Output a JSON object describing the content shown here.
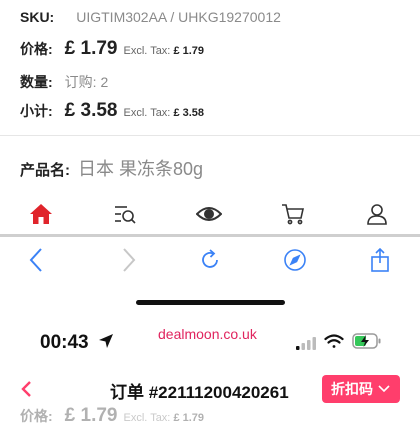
{
  "product": {
    "sku_label": "SKU:",
    "sku_value": "UIGTIM302AA / UHKG19270012",
    "price_label": "价格:",
    "price_value": "£ 1.79",
    "price_tax_label": "Excl. Tax:",
    "price_tax_value": "£ 1.79",
    "qty_label": "数量:",
    "qty_value": "订购: 2",
    "subtotal_label": "小计:",
    "subtotal_value": "£ 3.58",
    "subtotal_tax_label": "Excl. Tax:",
    "subtotal_tax_value": "£ 3.58",
    "name_label": "产品名:",
    "name_value": "日本 果冻条80g"
  },
  "tabbar": {
    "icons": [
      "home-icon",
      "search-list-icon",
      "eye-icon",
      "cart-icon",
      "profile-icon"
    ],
    "active_color": "#e0242b"
  },
  "browser": {
    "icons": [
      "back-icon",
      "forward-icon",
      "reload-icon",
      "compass-icon",
      "share-icon"
    ],
    "accent": "#3b82f6"
  },
  "status_bar": {
    "time": "00:43",
    "url": "dealmoon.co.uk"
  },
  "order": {
    "title": "订单 #22111200420261",
    "coupon_label": "折扣码",
    "partial_price_label": "价格:",
    "partial_price_value": "£ 1.79",
    "partial_tax_label": "Excl. Tax:",
    "partial_tax_value": "£ 1.79",
    "accent": "#ff3e6c"
  }
}
